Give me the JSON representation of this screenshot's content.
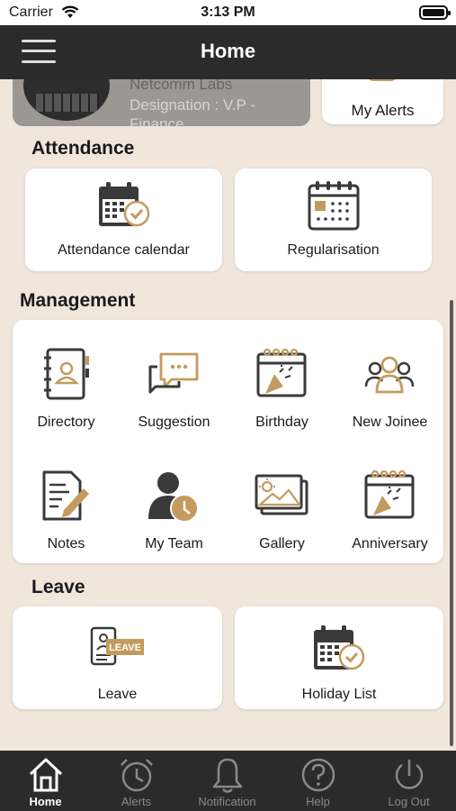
{
  "status_bar": {
    "carrier": "Carrier",
    "time": "3:13 PM"
  },
  "header": {
    "title": "Home"
  },
  "profile": {
    "company": "Netcomm Labs",
    "designation": "Designation : V.P - Finance"
  },
  "alerts_card": {
    "label": "My Alerts"
  },
  "sections": {
    "attendance": "Attendance",
    "management": "Management",
    "leave": "Leave"
  },
  "attendance_items": {
    "calendar": "Attendance calendar",
    "regularisation": "Regularisation"
  },
  "management_items": {
    "directory": "Directory",
    "suggestion": "Suggestion",
    "birthday": "Birthday",
    "new_joinee": "New Joinee",
    "notes": "Notes",
    "my_team": "My Team",
    "gallery": "Gallery",
    "anniversary": "Anniversary"
  },
  "leave_items": {
    "leave": "Leave",
    "holiday_list": "Holiday List",
    "badge": "LEAVE"
  },
  "tabs": {
    "home": "Home",
    "alerts": "Alerts",
    "notification": "Notification",
    "help": "Help",
    "logout": "Log Out"
  },
  "colors": {
    "accent": "#c49a5e",
    "dark": "#2b2b2b",
    "background": "#f0e6dc"
  }
}
